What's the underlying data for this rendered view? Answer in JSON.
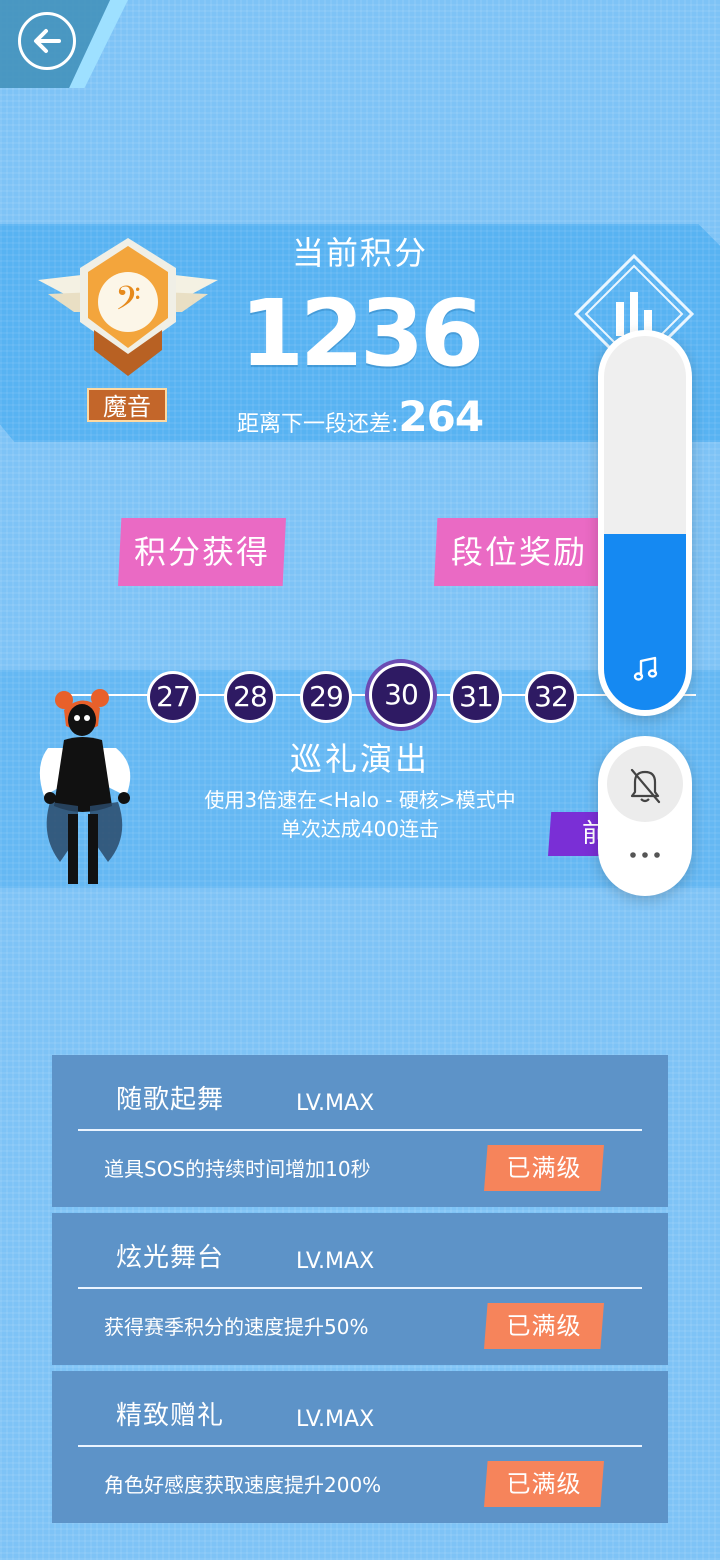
{
  "header": {
    "back_icon": "back-arrow-icon"
  },
  "score": {
    "title": "当前积分",
    "value": "1236",
    "next_label": "距离下一段还差:",
    "next_value": "264",
    "rank_name": "魔音",
    "stats_icon": "stats-icon"
  },
  "buttons": {
    "points_obtain": "积分获得",
    "rank_reward": "段位奖励"
  },
  "levels": {
    "nodes": [
      "27",
      "28",
      "29",
      "30",
      "31",
      "32"
    ],
    "current": "30",
    "reward_title": "巡礼演出",
    "reward_desc_line1": "使用3倍速在<Halo - 硬核>模式中",
    "reward_desc_line2": "单次达成400连击",
    "go_button": "前"
  },
  "skills": [
    {
      "name": "随歌起舞",
      "level": "LV.MAX",
      "desc": "道具SOS的持续时间增加10秒",
      "button": "已满级"
    },
    {
      "name": "炫光舞台",
      "level": "LV.MAX",
      "desc": "获得赛季积分的速度提升50%",
      "button": "已满级"
    },
    {
      "name": "精致赠礼",
      "level": "LV.MAX",
      "desc": "角色好感度获取速度提升200%",
      "button": "已满级"
    }
  ],
  "volume_overlay": {
    "level": 0.47,
    "music_icon": "music-note-icon",
    "mute_icon": "bell-off-icon",
    "more_icon": "more-dots-icon"
  },
  "colors": {
    "accent_pink": "#ea6ac4",
    "maxed_orange": "#f6845b",
    "volume_blue": "#1589f2",
    "node_purple": "#2e1a63"
  }
}
